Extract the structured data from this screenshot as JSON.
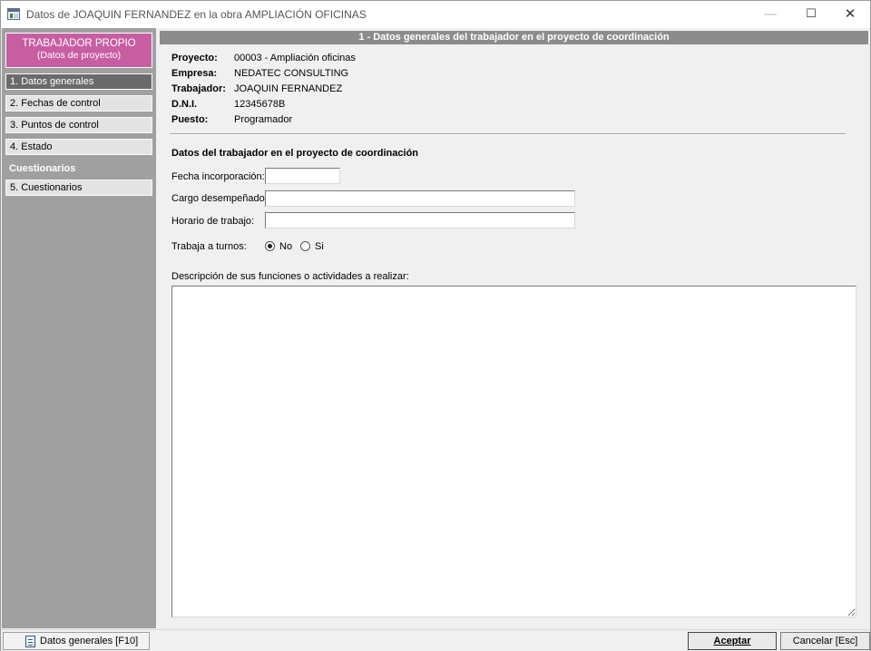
{
  "window": {
    "title": "Datos de JOAQUIN FERNANDEZ en la obra AMPLIACIÓN OFICINAS",
    "minimize_glyph": "—",
    "maximize_glyph": "☐",
    "close_glyph": "✕"
  },
  "sidebar": {
    "header_line1": "TRABAJADOR PROPIO",
    "header_line2": "(Datos de proyecto)",
    "header_color": "#c85ea2",
    "items": [
      {
        "label": "1. Datos generales"
      },
      {
        "label": "2. Fechas de control"
      },
      {
        "label": "3. Puntos de control"
      },
      {
        "label": "4. Estado"
      }
    ],
    "section_label": "Cuestionarios",
    "section_items": [
      {
        "label": "5. Cuestionarios"
      }
    ]
  },
  "main": {
    "header": "1 - Datos generales del trabajador en el proyecto de coordinación",
    "info": [
      {
        "label": "Proyecto:",
        "value": "00003 - Ampliación oficinas"
      },
      {
        "label": "Empresa:",
        "value": "NEDATEC CONSULTING"
      },
      {
        "label": "Trabajador:",
        "value": "JOAQUIN FERNANDEZ"
      },
      {
        "label": "D.N.I.",
        "value": "12345678B"
      },
      {
        "label": "Puesto:",
        "value": "Programador"
      }
    ],
    "section_title": "Datos del trabajador en el proyecto de coordinación",
    "fields": {
      "fecha_label": "Fecha incorporación:",
      "fecha_value": "",
      "cargo_label": "Cargo desempeñado:",
      "cargo_value": "",
      "horario_label": "Horario de trabajo:",
      "horario_value": ""
    },
    "turnos": {
      "label": "Trabaja a turnos:",
      "options": [
        "No",
        "Si"
      ],
      "selected": "No"
    },
    "description_label": "Descripción de sus funciones o actividades a realizar:",
    "description_value": ""
  },
  "footer": {
    "status_label": "Datos generales [F10]",
    "accept_label": "Aceptar",
    "cancel_label": "Cancelar  [Esc]"
  }
}
